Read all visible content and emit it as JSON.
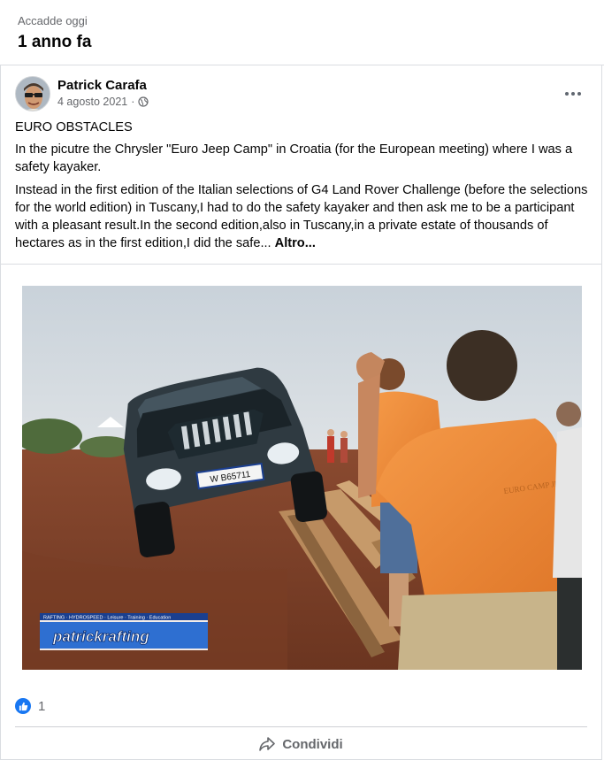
{
  "memory": {
    "kicker": "Accadde oggi",
    "title": "1 anno fa"
  },
  "post": {
    "author": "Patrick Carafa",
    "date": "4 agosto 2021",
    "separator": "·",
    "privacy_icon": "globe-icon",
    "options_icon": "more-options-icon",
    "headline": "EURO OBSTACLES",
    "paragraph1": "In the picutre the Chrysler \"Euro Jeep Camp\" in Croatia (for the European meeting) where I was a safety kayaker.",
    "paragraph2": "Instead in the first edition of the Italian selections of G4 Land Rover Challenge (before the selections for the world edition) in Tuscany,I had to do the safety kayaker and then ask me to be a participant with a pleasant result.In the second edition,also in Tuscany,in a private estate of thousands of hectares as in the first edition,I did the safe...",
    "see_more": "Altro..."
  },
  "photo": {
    "plate": "W B65711",
    "shirt_text": "EURO CAMP JEEP",
    "logo_top": "RAFTING · HYDROSPEED · Leisure · Training · Education",
    "logo_main": "patrickrafting"
  },
  "reactions": {
    "icon": "like-icon",
    "count": "1",
    "color": "#1877f2"
  },
  "actions": {
    "share_label": "Condividi",
    "share_icon": "share-arrow-icon"
  }
}
